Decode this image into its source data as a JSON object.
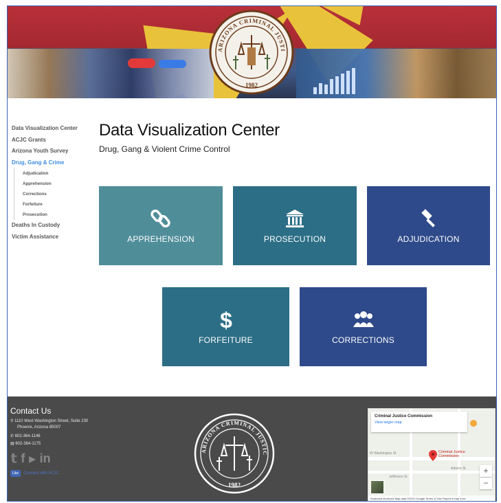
{
  "banner": {
    "seal_text": "ARIZONA CRIMINAL JUSTICE COMMISSION",
    "seal_year": "1982"
  },
  "sidebar": {
    "items": [
      {
        "label": "Data Visualization Center"
      },
      {
        "label": "ACJC Grants"
      },
      {
        "label": "Arizona Youth Survey"
      },
      {
        "label": "Drug, Gang & Crime"
      }
    ],
    "subitems": [
      {
        "label": "Adjudication"
      },
      {
        "label": "Apprehension"
      },
      {
        "label": "Corrections"
      },
      {
        "label": "Forfeiture"
      },
      {
        "label": "Prosecution"
      }
    ],
    "after_items": [
      {
        "label": "Deaths In Custody"
      },
      {
        "label": "Victim Assistance"
      }
    ]
  },
  "main": {
    "title": "Data Visualization Center",
    "subtitle": "Drug, Gang & Violent Crime Control",
    "tiles": [
      {
        "label": "APPREHENSION",
        "icon": "link-icon"
      },
      {
        "label": "PROSECUTION",
        "icon": "courthouse-icon"
      },
      {
        "label": "ADJUDICATION",
        "icon": "gavel-icon"
      },
      {
        "label": "FORFEITURE",
        "icon": "dollar-icon"
      },
      {
        "label": "CORRECTIONS",
        "icon": "users-icon"
      }
    ]
  },
  "footer": {
    "contact_title": "Contact Us",
    "address_line1": "1110 West Washington Street, Suite 230",
    "address_line2": "Phoenix, Arizona 85007",
    "phone": "602-364-1146",
    "fax": "602-364-1175",
    "social_icons": [
      "twitter-icon",
      "facebook-icon",
      "youtube-icon",
      "linkedin-icon"
    ],
    "fb_like": "Like",
    "connect_text": "Connect with ACJC",
    "seal_text": "ARIZONA CRIMINAL JUSTICE COMMISSION",
    "seal_year": "1982"
  },
  "map": {
    "card_title": "Criminal Justice Commission",
    "card_link": "View larger map",
    "pin_label_1": "Criminal Justice",
    "pin_label_2": "Commission",
    "street_1": "W Washington St",
    "street_2": "Jefferson St",
    "street_3": "Adams St",
    "zoom_in": "+",
    "zoom_out": "−",
    "attribution": "Keyboard shortcuts   Map data ©2021 Google   Terms of Use   Report a map error"
  },
  "colors": {
    "tile_teal_light": "#4f8d99",
    "tile_teal": "#2c6e86",
    "tile_navy": "#2e4a8a",
    "sidebar_active": "#3f8de0",
    "footer_bg": "#4a4a4a"
  }
}
